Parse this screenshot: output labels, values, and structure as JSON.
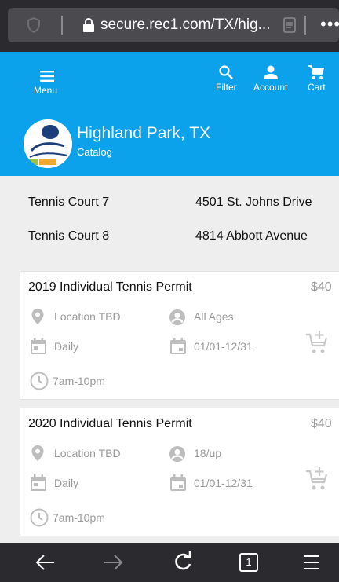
{
  "browser": {
    "url": "secure.rec1.com/TX/hig...",
    "more_label": "•••",
    "tab_count": "1"
  },
  "header": {
    "menu_label": "Menu",
    "filter_label": "Filter",
    "account_label": "Account",
    "cart_label": "Cart",
    "org_title": "Highland Park, TX",
    "org_subtitle": "Catalog",
    "colors": {
      "primary": "#0ba2eb"
    }
  },
  "locations": [
    {
      "name": "Tennis Court 7",
      "address": "4501 St. Johns Drive"
    },
    {
      "name": "Tennis Court 8",
      "address": "4814 Abbott Avenue"
    }
  ],
  "items": [
    {
      "title": "2019 Individual Tennis Permit",
      "price": "$40",
      "location": "Location TBD",
      "ages": "All Ages",
      "frequency": "Daily",
      "dates": "01/01-12/31",
      "time": "7am-10pm"
    },
    {
      "title": "2020 Individual Tennis Permit",
      "price": "$40",
      "location": "Location TBD",
      "ages": "18/up",
      "frequency": "Daily",
      "dates": "01/01-12/31",
      "time": "7am-10pm"
    }
  ]
}
